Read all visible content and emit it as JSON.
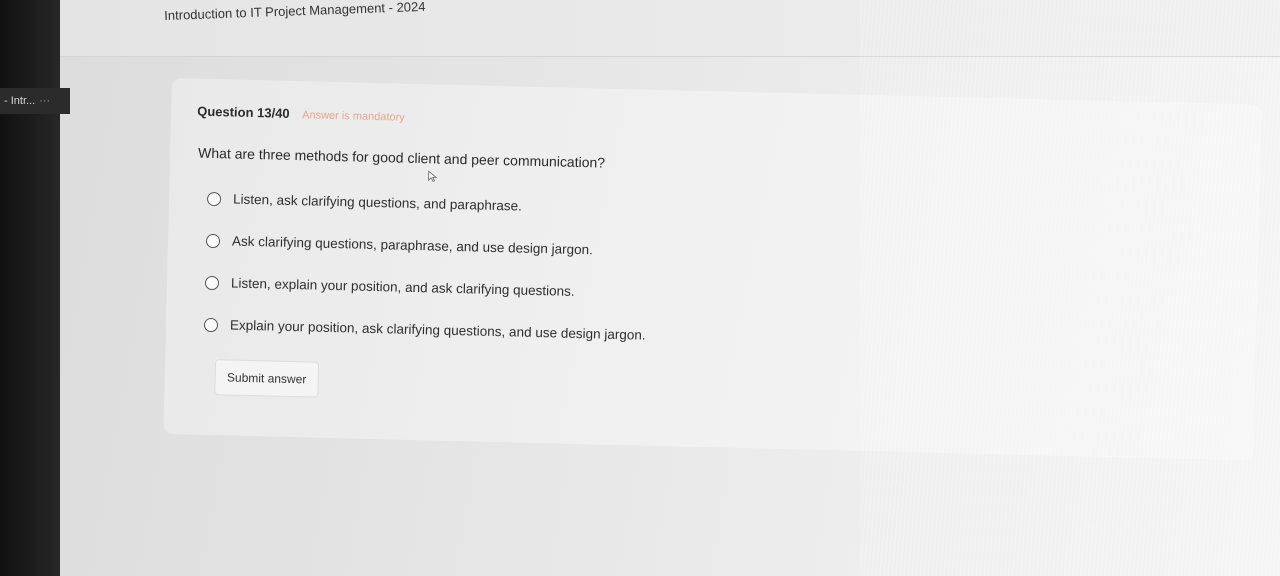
{
  "sidebar": {
    "tab_label": "- Intr...",
    "tab_more": "···"
  },
  "header": {
    "course_title": "Introduction to IT Project Management - 2024"
  },
  "question": {
    "number_label": "Question 13/40",
    "mandatory_label": "Answer is mandatory",
    "text": "What are three methods for good client and peer communication?",
    "options": [
      {
        "label": "Listen, ask clarifying questions, and paraphrase."
      },
      {
        "label": "Ask clarifying questions, paraphrase, and use design jargon."
      },
      {
        "label": "Listen, explain your position, and ask clarifying questions."
      },
      {
        "label": "Explain your position, ask clarifying questions, and use design jargon."
      }
    ],
    "submit_label": "Submit answer"
  },
  "colors": {
    "mandatory": "#e8a48a",
    "text": "#2a2a2a"
  }
}
